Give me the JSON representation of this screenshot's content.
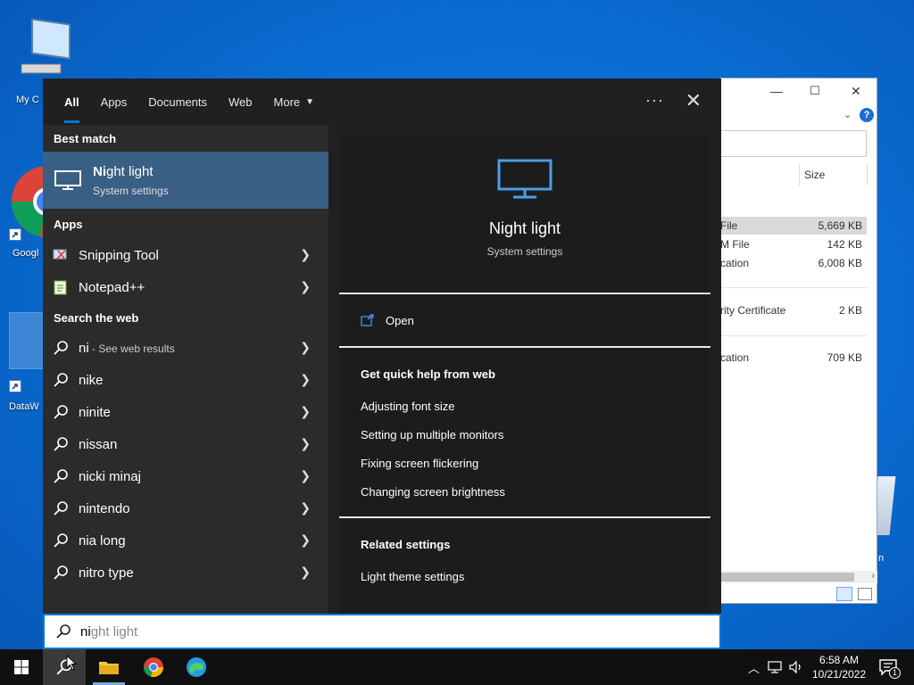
{
  "desktop": {
    "icons": [
      {
        "label": "My C"
      },
      {
        "label": "Googl"
      },
      {
        "label": "DataW"
      }
    ]
  },
  "explorer": {
    "size_header": "Size",
    "rows": [
      {
        "type": "File",
        "size": "5,669 KB"
      },
      {
        "type": "M File",
        "size": "142 KB"
      },
      {
        "type": "cation",
        "size": "6,008 KB"
      },
      {
        "type": "rity Certificate",
        "size": "2 KB"
      },
      {
        "type": "cation",
        "size": "709 KB"
      }
    ],
    "recycle_label": "n"
  },
  "search": {
    "tabs": [
      "All",
      "Apps",
      "Documents",
      "Web",
      "More"
    ],
    "more_icon": "···",
    "close_icon": "✕",
    "best_match_header": "Best match",
    "best_match": {
      "name_bold": "Ni",
      "name_rest": "ght light",
      "kind": "System settings"
    },
    "apps_header": "Apps",
    "apps": [
      "Snipping Tool",
      "Notepad++"
    ],
    "web_header": "Search the web",
    "web_first": {
      "term": "ni",
      "suffix": " - See web results"
    },
    "web_items": [
      "nike",
      "ninite",
      "nissan",
      "nicki minaj",
      "nintendo",
      "nia long",
      "nitro type"
    ],
    "preview": {
      "name": "Night light",
      "kind": "System settings",
      "open_label": "Open",
      "help_header": "Get quick help from web",
      "help_links": [
        "Adjusting font size",
        "Setting up multiple monitors",
        "Fixing screen flickering",
        "Changing screen brightness"
      ],
      "related_header": "Related settings",
      "related_links": [
        "Light theme settings"
      ]
    },
    "query_typed": "ni",
    "query_ghost": "ght light"
  },
  "taskbar": {
    "time": "6:58 AM",
    "date": "10/21/2022",
    "notification_count": "1"
  },
  "colors": {
    "accent": "#0078d7",
    "panel_bg": "#202020",
    "best_match_bg": "#3a5f84"
  }
}
